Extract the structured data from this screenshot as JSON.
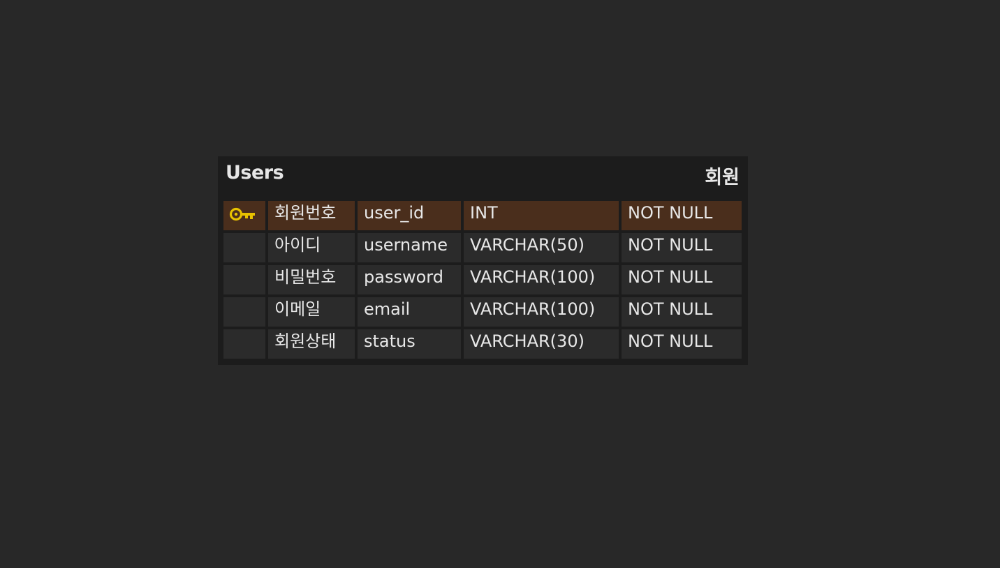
{
  "entity": {
    "name": "Users",
    "logical_name": "회원",
    "columns": [
      {
        "logical": "회원번호",
        "physical": "user_id",
        "type": "INT",
        "nullability": "NOT NULL",
        "primary_key": true
      },
      {
        "logical": "아이디",
        "physical": "username",
        "type": "VARCHAR(50)",
        "nullability": "NOT NULL",
        "primary_key": false
      },
      {
        "logical": "비밀번호",
        "physical": "password",
        "type": "VARCHAR(100)",
        "nullability": "NOT NULL",
        "primary_key": false
      },
      {
        "logical": "이메일",
        "physical": "email",
        "type": "VARCHAR(100)",
        "nullability": "NOT NULL",
        "primary_key": false
      },
      {
        "logical": "회원상태",
        "physical": "status",
        "type": "VARCHAR(30)",
        "nullability": "NOT NULL",
        "primary_key": false
      }
    ]
  },
  "colors": {
    "background": "#282828",
    "entity_body": "#1c1c1c",
    "cell": "#2b2b2b",
    "primary_key_row": "#4a2e1c",
    "key_icon": "#e8c200",
    "text": "#e8e8e8"
  },
  "icons": {
    "primary_key": "key-icon"
  }
}
